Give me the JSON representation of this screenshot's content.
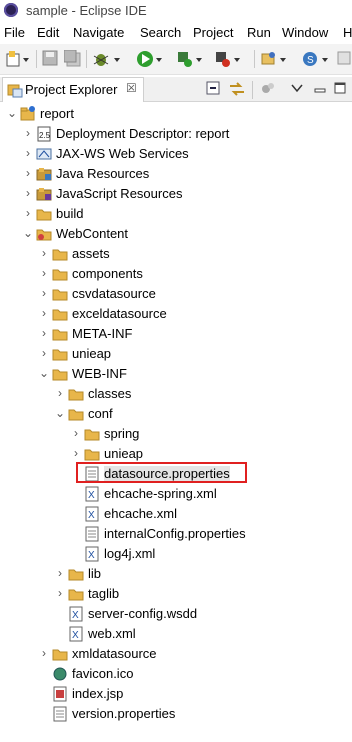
{
  "window": {
    "title": "sample - Eclipse IDE"
  },
  "menu": [
    "File",
    "Edit",
    "Navigate",
    "Search",
    "Project",
    "Run",
    "Window",
    "H"
  ],
  "view": {
    "tab_label": "Project Explorer",
    "close_glyph": "☒"
  },
  "tree": [
    {
      "label": "report",
      "depth": 0,
      "arrow": "v",
      "icon": "project-icon"
    },
    {
      "label": "Deployment Descriptor: report",
      "depth": 1,
      "arrow": ">",
      "icon": "deployment-descriptor-icon"
    },
    {
      "label": "JAX-WS Web Services",
      "depth": 1,
      "arrow": ">",
      "icon": "web-services-icon"
    },
    {
      "label": "Java Resources",
      "depth": 1,
      "arrow": ">",
      "icon": "java-resources-icon"
    },
    {
      "label": "JavaScript Resources",
      "depth": 1,
      "arrow": ">",
      "icon": "javascript-resources-icon"
    },
    {
      "label": "build",
      "depth": 1,
      "arrow": ">",
      "icon": "folder-icon"
    },
    {
      "label": "WebContent",
      "depth": 1,
      "arrow": "v",
      "icon": "web-folder-icon"
    },
    {
      "label": "assets",
      "depth": 2,
      "arrow": ">",
      "icon": "folder-icon"
    },
    {
      "label": "components",
      "depth": 2,
      "arrow": ">",
      "icon": "folder-icon"
    },
    {
      "label": "csvdatasource",
      "depth": 2,
      "arrow": ">",
      "icon": "folder-icon"
    },
    {
      "label": "exceldatasource",
      "depth": 2,
      "arrow": ">",
      "icon": "folder-icon"
    },
    {
      "label": "META-INF",
      "depth": 2,
      "arrow": ">",
      "icon": "folder-icon"
    },
    {
      "label": "unieap",
      "depth": 2,
      "arrow": ">",
      "icon": "folder-icon"
    },
    {
      "label": "WEB-INF",
      "depth": 2,
      "arrow": "v",
      "icon": "folder-icon"
    },
    {
      "label": "classes",
      "depth": 3,
      "arrow": ">",
      "icon": "folder-icon"
    },
    {
      "label": "conf",
      "depth": 3,
      "arrow": "v",
      "icon": "folder-icon"
    },
    {
      "label": "spring",
      "depth": 4,
      "arrow": ">",
      "icon": "folder-icon"
    },
    {
      "label": "unieap",
      "depth": 4,
      "arrow": ">",
      "icon": "folder-icon"
    },
    {
      "label": "datasource.properties",
      "depth": 4,
      "arrow": "",
      "icon": "properties-file-icon",
      "selected": true
    },
    {
      "label": "ehcache-spring.xml",
      "depth": 4,
      "arrow": "",
      "icon": "xml-file-icon"
    },
    {
      "label": "ehcache.xml",
      "depth": 4,
      "arrow": "",
      "icon": "xml-file-icon"
    },
    {
      "label": "internalConfig.properties",
      "depth": 4,
      "arrow": "",
      "icon": "properties-file-icon"
    },
    {
      "label": "log4j.xml",
      "depth": 4,
      "arrow": "",
      "icon": "xml-file-icon"
    },
    {
      "label": "lib",
      "depth": 3,
      "arrow": ">",
      "icon": "folder-icon"
    },
    {
      "label": "taglib",
      "depth": 3,
      "arrow": ">",
      "icon": "folder-icon"
    },
    {
      "label": "server-config.wsdd",
      "depth": 3,
      "arrow": "",
      "icon": "xml-file-icon"
    },
    {
      "label": "web.xml",
      "depth": 3,
      "arrow": "",
      "icon": "xml-file-icon"
    },
    {
      "label": "xmldatasource",
      "depth": 2,
      "arrow": ">",
      "icon": "folder-icon"
    },
    {
      "label": "favicon.ico",
      "depth": 2,
      "arrow": "",
      "icon": "image-file-icon"
    },
    {
      "label": "index.jsp",
      "depth": 2,
      "arrow": "",
      "icon": "jsp-file-icon"
    },
    {
      "label": "version.properties",
      "depth": 2,
      "arrow": "",
      "icon": "properties-file-icon"
    }
  ],
  "colors": {
    "folder": "#e8b64a",
    "selection_box": "#e02020",
    "selected_bg": "#e4e4e4"
  }
}
